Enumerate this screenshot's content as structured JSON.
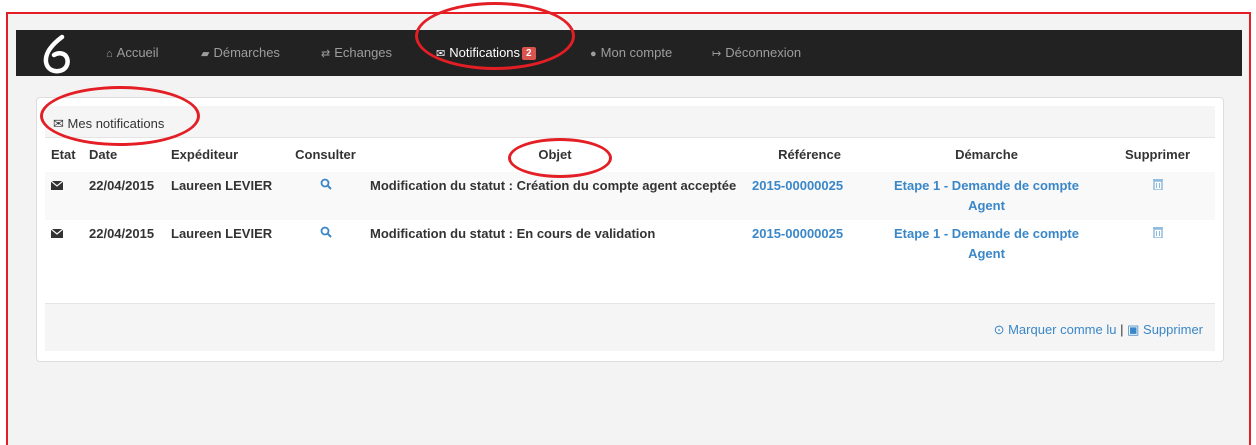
{
  "nav": {
    "items": [
      {
        "icon": "home-icon",
        "glyph": "⌂",
        "label": "Accueil"
      },
      {
        "icon": "folder-icon",
        "glyph": "▰",
        "label": "Démarches"
      },
      {
        "icon": "exchange-icon",
        "glyph": "⇄",
        "label": "Echanges"
      },
      {
        "icon": "envelope-icon",
        "glyph": "✉",
        "label": "Notifications",
        "badge": "2",
        "active": true
      },
      {
        "icon": "user-icon",
        "glyph": "●",
        "label": "Mon compte"
      },
      {
        "icon": "logout-icon",
        "glyph": "↦",
        "label": "Déconnexion"
      }
    ]
  },
  "panel": {
    "title": "Mes notifications"
  },
  "table": {
    "headers": {
      "etat": "Etat",
      "date": "Date",
      "expediteur": "Expéditeur",
      "consulter": "Consulter",
      "objet": "Objet",
      "reference": "Référence",
      "demarche": "Démarche",
      "supprimer": "Supprimer"
    },
    "rows": [
      {
        "date": "22/04/2015",
        "expediteur": "Laureen LEVIER",
        "objet": "Modification du statut : Création du compte agent acceptée",
        "reference": "2015-00000025",
        "demarche": "Etape 1 - Demande de compte Agent"
      },
      {
        "date": "22/04/2015",
        "expediteur": "Laureen LEVIER",
        "objet": "Modification du statut : En cours de validation",
        "reference": "2015-00000025",
        "demarche": "Etape 1 - Demande de compte Agent"
      }
    ]
  },
  "footer": {
    "mark_read": "Marquer comme lu",
    "separator": "|",
    "delete": "Supprimer"
  },
  "colors": {
    "navbar": "#222222",
    "link": "#3a87c8",
    "annotation": "#e31e24",
    "badge": "#d9534f"
  }
}
